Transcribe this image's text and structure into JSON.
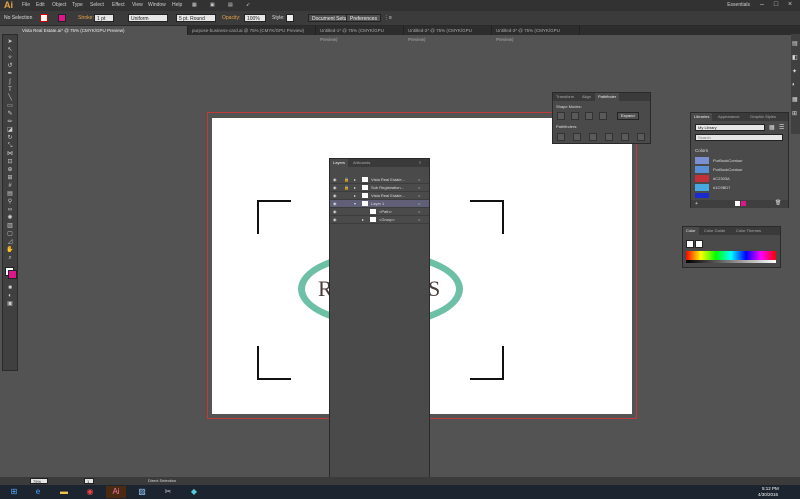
{
  "menubar": {
    "logo": "Ai",
    "items": [
      "File",
      "Edit",
      "Object",
      "Type",
      "Select",
      "Effect",
      "View",
      "Window",
      "Help"
    ],
    "workspace": "Essentials",
    "search_placeholder": ""
  },
  "controlbar": {
    "selection_label": "No Selection",
    "stroke_label": "Stroke:",
    "stroke_weight": "1 pt",
    "profile_value": "Uniform",
    "brush_value": "5 pt. Round",
    "opacity_label": "Opacity:",
    "opacity_value": "100%",
    "style_label": "Style:",
    "document_setup_label": "Document Setup",
    "preferences_label": "Preferences"
  },
  "tabs": [
    {
      "label": "Vista Real Estate.ai* @ 75% (CMYK/GPU Preview)",
      "active": true
    },
    {
      "label": "purpose-business-card.ai @ 75% (CMYK/GPU Preview)",
      "active": false
    },
    {
      "label": "Untitled-1* @ 75% (CMYK/GPU Preview)",
      "active": false
    },
    {
      "label": "Untitled-2* @ 75% (CMYK/GPU Preview)",
      "active": false
    },
    {
      "label": "Untitled-3* @ 75% (CMYK/GPU Preview)",
      "active": false
    }
  ],
  "artboard": {
    "logo_text_left": "R",
    "logo_text_right": "S",
    "accent_color": "#6dbfa6",
    "bleed_color": "#c0393b"
  },
  "layers_panel": {
    "tabs": [
      "Layers",
      "Artboards"
    ],
    "rows": [
      {
        "name": "Vista Real Estate...",
        "selected": false,
        "indent": 0
      },
      {
        "name": "Sub Registration...",
        "selected": false,
        "indent": 0
      },
      {
        "name": "Vista Real Estate...",
        "selected": false,
        "indent": 0
      },
      {
        "name": "Layer 1",
        "selected": true,
        "indent": 0
      },
      {
        "name": "<Path>",
        "selected": false,
        "indent": 1
      },
      {
        "name": "<Group>",
        "selected": false,
        "indent": 1
      }
    ]
  },
  "pathfinder_panel": {
    "tabs": [
      "Transform",
      "Align",
      "Pathfinder"
    ],
    "shape_modes_label": "Shape Modes:",
    "pathfinders_label": "Pathfinders:",
    "expand_label": "Expand"
  },
  "libraries_panel": {
    "tabs": [
      "Libraries",
      "Appearance",
      "Graphic Styles"
    ],
    "library_name": "My Library",
    "search_placeholder": "Search",
    "colors_label": "Colors",
    "colors": [
      {
        "name": "PurBookContour",
        "hex": "#7b8fd1"
      },
      {
        "name": "PurBookContour",
        "hex": "#5a8fd6"
      },
      {
        "name": "#C2303A",
        "hex": "#c2303a"
      },
      {
        "name": "#1C9BD7",
        "hex": "#48a8e0"
      },
      {
        "name": "#1016BD",
        "hex": "#1c2bd0"
      }
    ]
  },
  "color_panel": {
    "tabs": [
      "Color",
      "Color Guide",
      "Color Themes"
    ]
  },
  "statusbar": {
    "zoom": "75%",
    "page": "1",
    "tool_name": "Direct Selection"
  },
  "taskbar": {
    "time": "5:12 PM",
    "date": "4/30/2016"
  }
}
